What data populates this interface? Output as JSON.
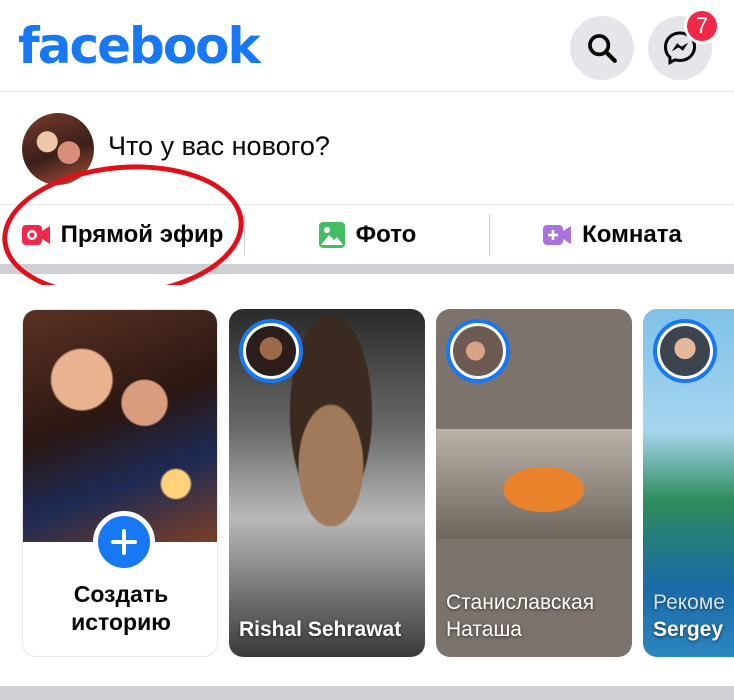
{
  "header": {
    "logo": "facebook",
    "search_icon": "search-icon",
    "messenger_icon": "messenger-icon",
    "messenger_badge": "7",
    "brand_color": "#1877f2"
  },
  "composer": {
    "placeholder": "Что у вас нового?"
  },
  "actions": [
    {
      "label": "Прямой эфир",
      "icon": "live-video-icon",
      "color": "#f02849"
    },
    {
      "label": "Фото",
      "icon": "photo-icon",
      "color": "#45bd62"
    },
    {
      "label": "Комната",
      "icon": "room-icon",
      "color": "#a972dc"
    }
  ],
  "stories": {
    "create": {
      "line1": "Создать",
      "line2": "историю"
    },
    "items": [
      {
        "name_line1": "Rishal Sehrawat",
        "name_line2": ""
      },
      {
        "name_line1": "Станиславская",
        "name_line2": "Наташа"
      },
      {
        "name_line1": "Рекоме",
        "name_line2": "Sergey"
      }
    ]
  }
}
